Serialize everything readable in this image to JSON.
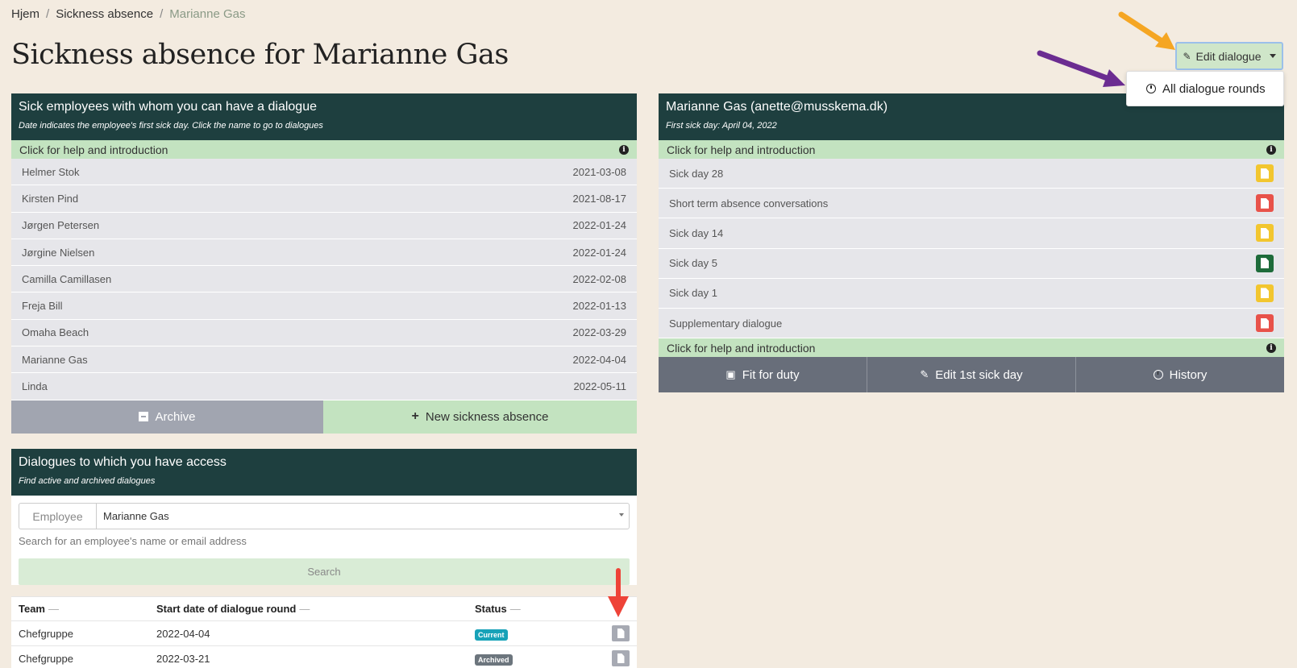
{
  "breadcrumb": {
    "home": "Hjem",
    "section": "Sickness absence",
    "current": "Marianne Gas"
  },
  "page_title": "Sickness absence for Marianne Gas",
  "edit_dialogue": {
    "label": "Edit dialogue",
    "menu_item": "All dialogue rounds"
  },
  "sick_panel": {
    "title": "Sick employees with whom you can have a dialogue",
    "subtitle": "Date indicates the employee's first sick day. Click the name to go to dialogues",
    "help": "Click for help and introduction",
    "employees": [
      {
        "name": "Helmer Stok",
        "date": "2021-03-08"
      },
      {
        "name": "Kirsten Pind",
        "date": "2021-08-17"
      },
      {
        "name": "Jørgen Petersen",
        "date": "2022-01-24"
      },
      {
        "name": "Jørgine Nielsen",
        "date": "2022-01-24"
      },
      {
        "name": "Camilla Camillasen",
        "date": "2022-02-08"
      },
      {
        "name": "Freja Bill",
        "date": "2022-01-13"
      },
      {
        "name": "Omaha Beach",
        "date": "2022-03-29"
      },
      {
        "name": "Marianne Gas",
        "date": "2022-04-04"
      },
      {
        "name": "Linda",
        "date": "2022-05-11"
      }
    ],
    "archive_label": "Archive",
    "new_label": "New sickness absence"
  },
  "employee_panel": {
    "title": "Marianne Gas (anette@musskema.dk)",
    "subtitle": "First sick day: April 04, 2022",
    "help": "Click for help and introduction",
    "help_bottom": "Click for help and introduction",
    "dialogues": [
      {
        "label": "Sick day 28",
        "color": "#f2c62f"
      },
      {
        "label": "Short term absence conversations",
        "color": "#e8524a"
      },
      {
        "label": "Sick day 14",
        "color": "#f2c62f"
      },
      {
        "label": "Sick day 5",
        "color": "#1e6b3a"
      },
      {
        "label": "Sick day 1",
        "color": "#f2c62f"
      },
      {
        "label": "Supplementary dialogue",
        "color": "#e8524a"
      }
    ],
    "actions": {
      "fit": "Fit for duty",
      "edit": "Edit 1st sick day",
      "history": "History"
    }
  },
  "dialogues_panel": {
    "title": "Dialogues to which you have access",
    "subtitle": "Find active and archived dialogues",
    "employee_label": "Employee",
    "employee_value": "Marianne Gas",
    "hint": "Search for an employee's name or email address",
    "search_label": "Search",
    "columns": {
      "team": "Team",
      "start": "Start date of dialogue round",
      "status": "Status"
    },
    "rows": [
      {
        "team": "Chefgruppe",
        "start": "2022-04-04",
        "status": "Current"
      },
      {
        "team": "Chefgruppe",
        "start": "2022-03-21",
        "status": "Archived"
      }
    ]
  }
}
